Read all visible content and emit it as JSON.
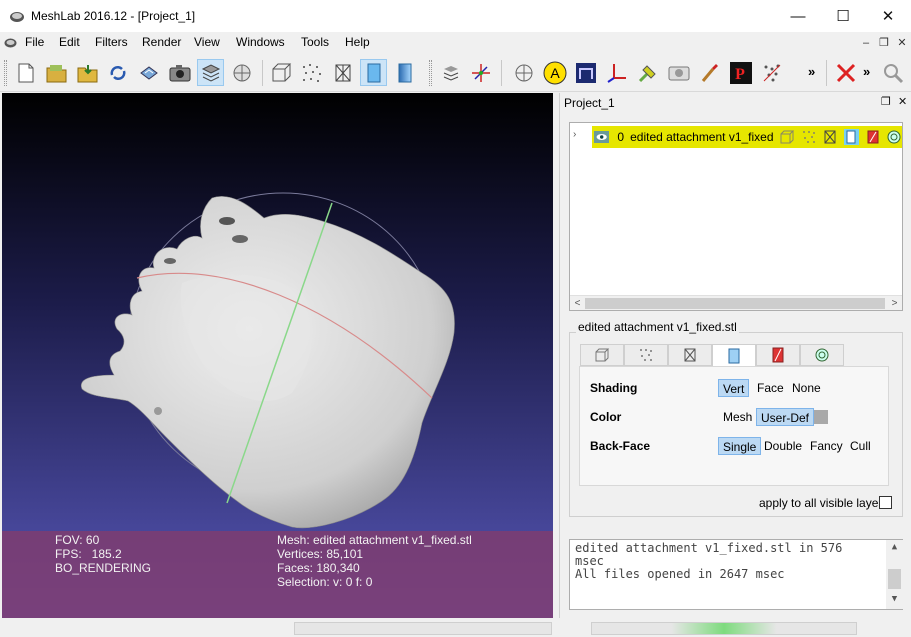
{
  "window": {
    "title": "MeshLab 2016.12 - [Project_1]",
    "minimize_glyph": "—",
    "maximize_glyph": "☐",
    "close_glyph": "✕"
  },
  "menubar": {
    "items": [
      "File",
      "Edit",
      "Filters",
      "Render",
      "View",
      "Windows",
      "Tools",
      "Help"
    ],
    "mdi_min": "–",
    "mdi_restore": "❐",
    "mdi_close": "✕"
  },
  "toolbar": {
    "icons": [
      "new-project-icon",
      "open-project-icon",
      "import-mesh-icon",
      "reload-icon",
      "export-mesh-icon",
      "snapshot-icon",
      "layers-icon",
      "raster-layers-icon",
      "bbox-render-icon",
      "points-render-icon",
      "wireframe-render-icon",
      "flat-render-icon",
      "smooth-render-icon",
      "lighting-icon",
      "trackball-icon",
      "select-icon",
      "annotate-icon",
      "align-icon",
      "measure-icon",
      "paint-icon",
      "pick-points-icon",
      "transfer-icon",
      "capture-icon",
      "brush-icon",
      "points-plugin-icon",
      "noise-icon",
      "delete-icon",
      "zoom-icon"
    ],
    "more_glyph": "»"
  },
  "viewport": {
    "fov": "FOV: 60",
    "fps": "FPS:   185.2",
    "mode": "BO_RENDERING",
    "mesh": "Mesh: edited attachment v1_fixed.stl",
    "vertices": "Vertices: 85,101",
    "faces": "Faces: 180,340",
    "selection": "Selection: v: 0 f: 0"
  },
  "dock": {
    "title": "Project_1",
    "float_glyph": "❐",
    "close_glyph": "✕",
    "layer": {
      "index": "0",
      "name": "edited attachment v1_fixed",
      "expander": "›"
    },
    "hscroll_left": "<",
    "hscroll_right": ">",
    "group_title": "edited attachment v1_fixed.stl",
    "render": {
      "shading_label": "Shading",
      "shading_options": [
        "Vert",
        "Face",
        "None"
      ],
      "color_label": "Color",
      "color_options": [
        "Mesh",
        "User-Def"
      ],
      "backface_label": "Back-Face",
      "backface_options": [
        "Single",
        "Double",
        "Fancy",
        "Cull"
      ]
    },
    "apply_label": "apply to all visible layers",
    "log": {
      "lines": [
        "edited attachment v1_fixed.stl in 576",
        "msec",
        "All files opened in 2647 msec"
      ],
      "up_glyph": "▲",
      "down_glyph": "▼"
    }
  },
  "colors": {
    "layer_highlight": "#e6e600",
    "info_overlay": "#803c6e",
    "viewport_gradient_top": "#000000",
    "viewport_gradient_bottom": "#5757b8"
  }
}
